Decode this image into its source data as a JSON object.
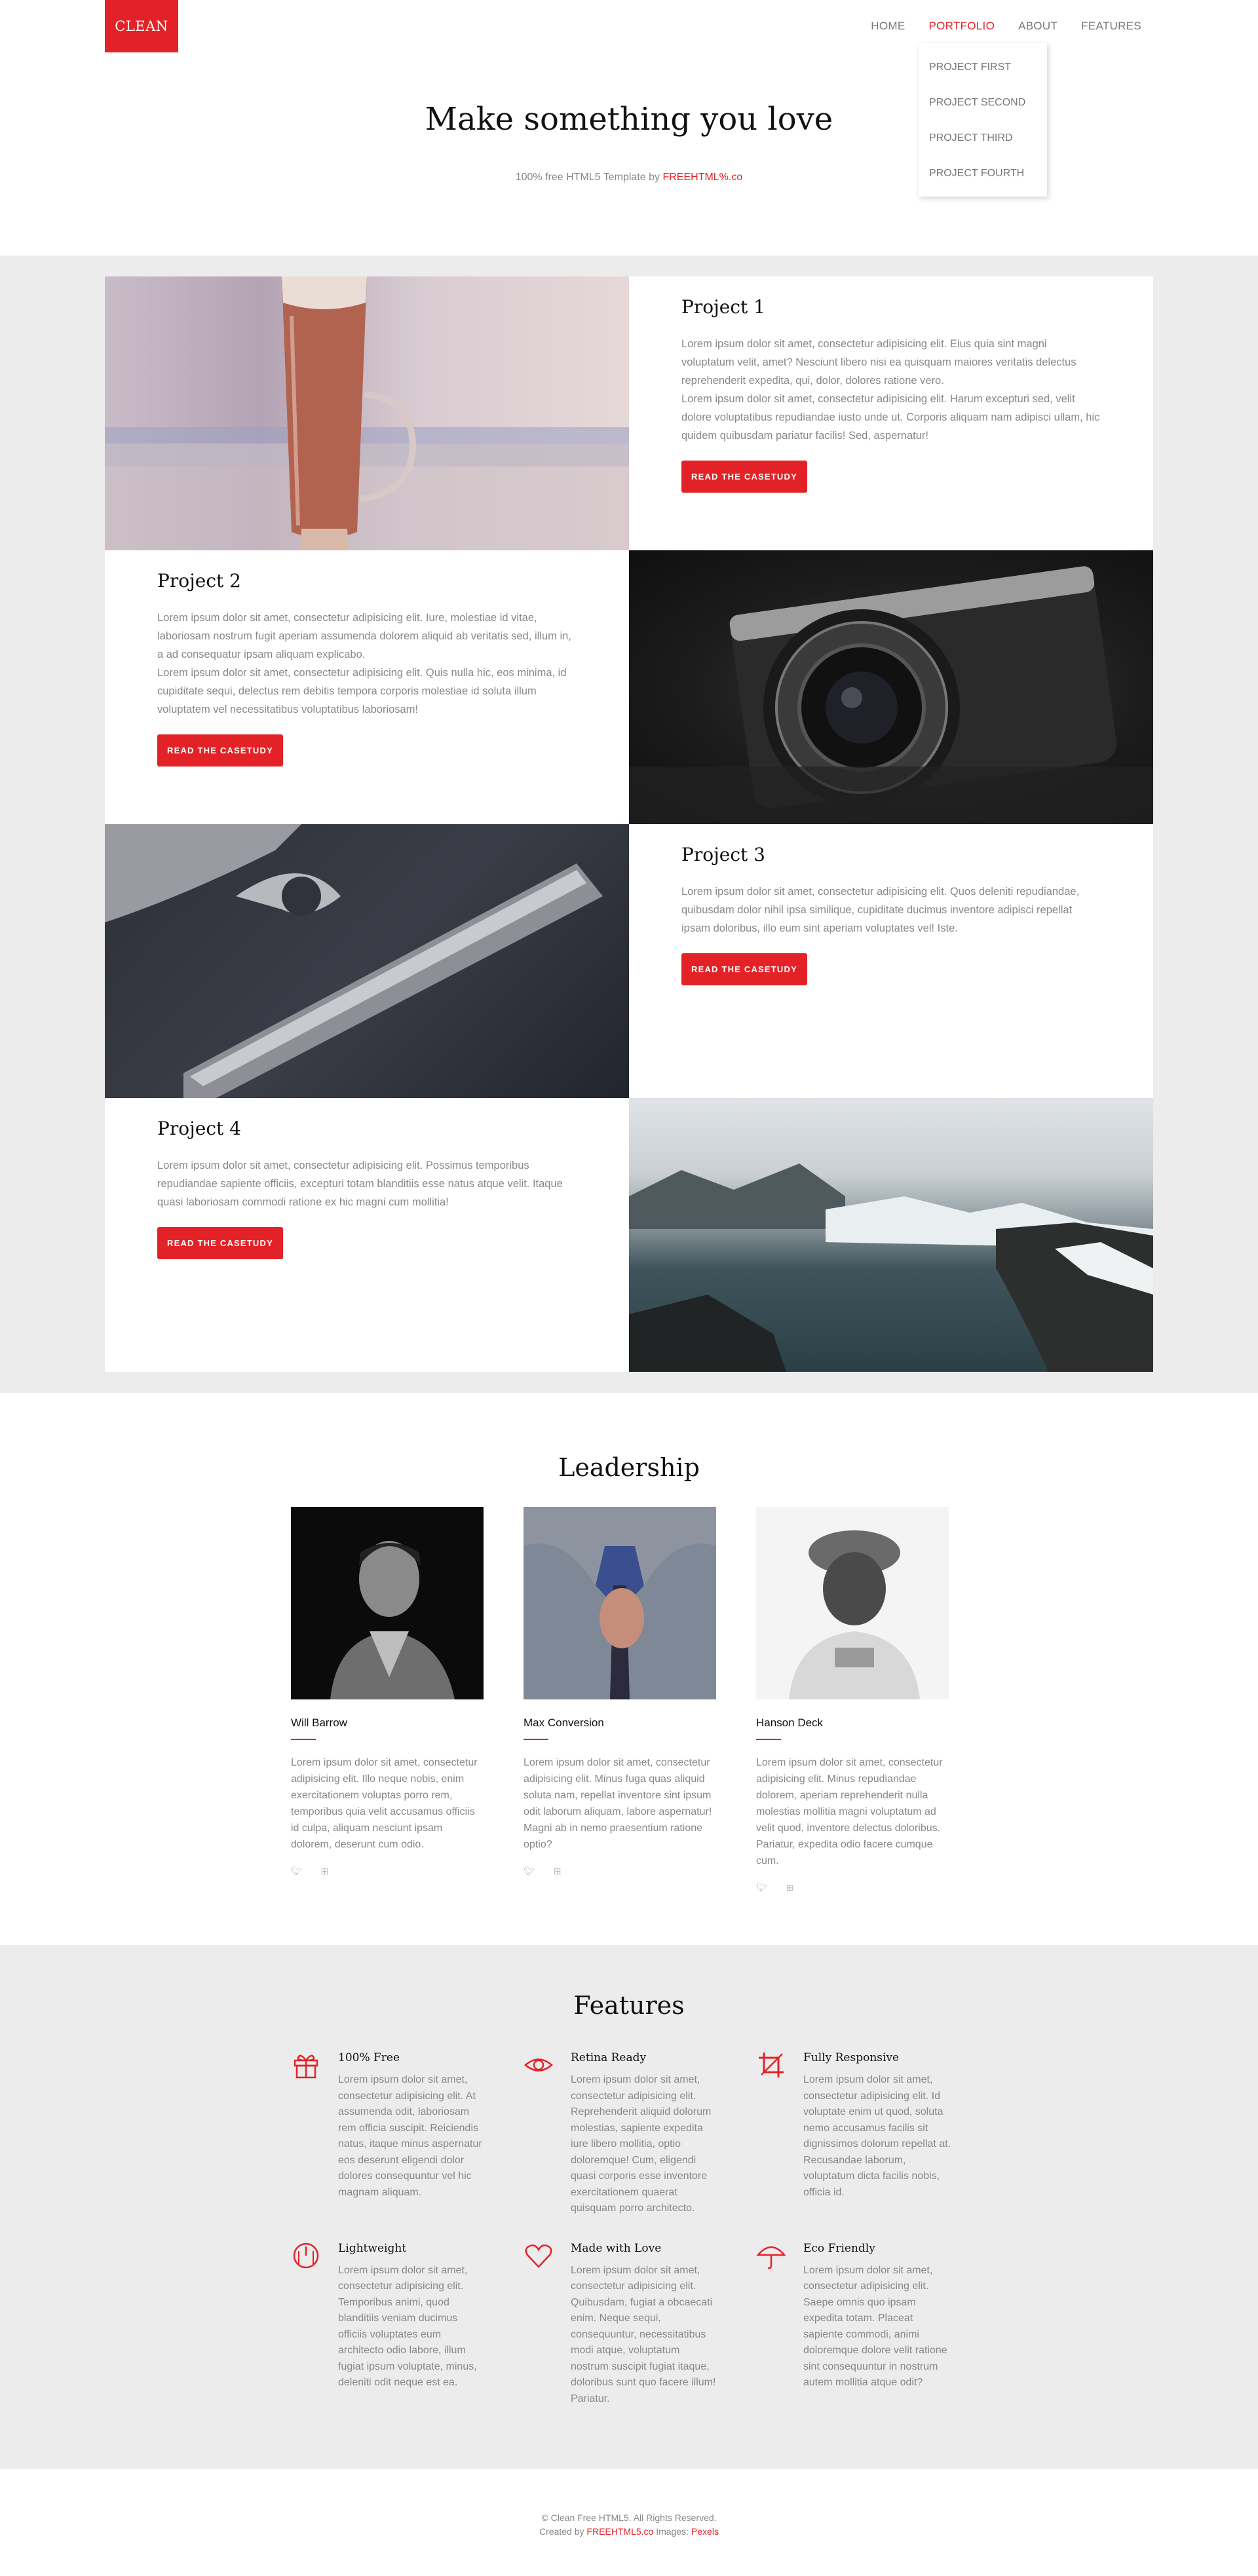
{
  "brand": {
    "logo": "CLEAN",
    "accent": "#e32227"
  },
  "nav": {
    "items": [
      {
        "label": "HOME"
      },
      {
        "label": "PORTFOLIO",
        "active": true
      },
      {
        "label": "ABOUT"
      },
      {
        "label": "FEATURES"
      }
    ],
    "dropdown": [
      "PROJECT FIRST",
      "PROJECT SECOND",
      "PROJECT THIRD",
      "PROJECT FOURTH"
    ]
  },
  "hero": {
    "title": "Make something you love",
    "subtitle_prefix": "100% free HTML5 Template by",
    "subtitle_link": "FREEHTML%.co"
  },
  "projects": [
    {
      "title": "Project 1",
      "body": "Lorem ipsum dolor sit amet, consectetur adipisicing elit. Eius quia sint magni voluptatum velit, amet? Nesciunt libero nisi ea quisquam maiores veritatis delectus reprehenderit expedita, qui, dolor, dolores ratione vero.\nLorem ipsum dolor sit amet, consectetur adipisicing elit. Harum excepturi sed, velit dolore voluptatibus repudiandae iusto unde ut. Corporis aliquam nam adipisci ullam, hic quidem quibusdam pariatur facilis! Sed, aspernatur!",
      "button": "READ THE CASETUDY",
      "image": "coffee-glass"
    },
    {
      "title": "Project 2",
      "body": "Lorem ipsum dolor sit amet, consectetur adipisicing elit. Iure, molestiae id vitae, laboriosam nostrum fugit aperiam assumenda dolorem aliquid ab veritatis sed, illum in, a ad consequatur ipsam aliquam explicabo.\nLorem ipsum dolor sit amet, consectetur adipisicing elit. Quis nulla hic, eos minima, id cupiditate sequi, delectus rem debitis tempora corporis molestiae id soluta illum voluptatem vel necessitatibus voluptatibus laboriosam!",
      "button": "READ THE CASETUDY",
      "image": "camera"
    },
    {
      "title": "Project 3",
      "body": "Lorem ipsum dolor sit amet, consectetur adipisicing elit. Quos deleniti repudiandae, quibusdam dolor nihil ipsa similique, cupiditate ducimus inventore adipisci repellat ipsam doloribus, illo eum sint aperiam voluptates vel! Iste.",
      "button": "READ THE CASETUDY",
      "image": "wrenches"
    },
    {
      "title": "Project 4",
      "body": "Lorem ipsum dolor sit amet, consectetur adipisicing elit. Possimus temporibus repudiandae sapiente officiis, excepturi totam blanditiis esse natus atque velit. Itaque quasi laboriosam commodi ratione ex hic magni cum mollitia!",
      "button": "READ THE CASETUDY",
      "image": "mountain-lake"
    }
  ],
  "leadership": {
    "title": "Leadership",
    "members": [
      {
        "name": "Will Barrow",
        "bio": "Lorem ipsum dolor sit amet, consectetur adipisicing elit. Illo neque nobis, enim exercitationem voluptas porro rem, temporibus quia velit accusamus officiis id culpa, aliquam nesciunt ipsam dolorem, deserunt cum odio."
      },
      {
        "name": "Max Conversion",
        "bio": "Lorem ipsum dolor sit amet, consectetur adipisicing elit. Minus fuga quas aliquid soluta nam, repellat inventore sint ipsum odit laborum aliquam, labore aspernatur! Magni ab in nemo praesentium ratione optio?"
      },
      {
        "name": "Hanson Deck",
        "bio": "Lorem ipsum dolor sit amet, consectetur adipisicing elit. Minus repudiandae dolorem, aperiam reprehenderit nulla molestias mollitia magni voluptatum ad velit quod, inventore delectus doloribus. Pariatur, expedita odio facere cumque cum."
      }
    ],
    "social_icons": [
      "twitter-icon",
      "dribbble-icon"
    ]
  },
  "features": {
    "title": "Features",
    "items": [
      {
        "name": "100% Free",
        "icon": "gift-icon",
        "body": "Lorem ipsum dolor sit amet, consectetur adipisicing elit. At assumenda odit, laboriosam rem officia suscipit. Reiciendis natus, itaque minus aspernatur eos deserunt eligendi dolor dolores consequuntur vel hic magnam aliquam."
      },
      {
        "name": "Retina Ready",
        "icon": "eye-icon",
        "body": "Lorem ipsum dolor sit amet, consectetur adipisicing elit. Reprehenderit aliquid dolorum molestias, sapiente expedita iure libero mollitia, optio doloremque! Cum, eligendi quasi corporis esse inventore exercitationem quaerat quisquam porro architecto."
      },
      {
        "name": "Fully Responsive",
        "icon": "crop-icon",
        "body": "Lorem ipsum dolor sit amet, consectetur adipisicing elit. Id voluptate enim ut quod, soluta nemo accusamus facilis sit dignissimos dolorum repellat at. Recusandae laborum, voluptatum dicta facilis nobis, officia id."
      },
      {
        "name": "Lightweight",
        "icon": "gauge-icon",
        "body": "Lorem ipsum dolor sit amet, consectetur adipisicing elit. Temporibus animi, quod blanditiis veniam ducimus officiis voluptates eum architecto odio labore, illum fugiat ipsum voluptate, minus, deleniti odit neque est ea."
      },
      {
        "name": "Made with Love",
        "icon": "heart-icon",
        "body": "Lorem ipsum dolor sit amet, consectetur adipisicing elit. Quibusdam, fugiat a obcaecati enim. Neque sequi, consequuntur, necessitatibus modi atque, voluptatum nostrum suscipit fugiat itaque, doloribus sunt quo facere illum! Pariatur."
      },
      {
        "name": "Eco Friendly",
        "icon": "umbrella-icon",
        "body": "Lorem ipsum dolor sit amet, consectetur adipisicing elit. Saepe omnis quo ipsam expedita totam. Placeat sapiente commodi, animi doloremque dolore velit ratione sint consequuntur in nostrum autem mollitia atque odit?"
      }
    ]
  },
  "footer": {
    "copyright": "© Clean Free HTML5. All Rights Reserved.",
    "created_prefix": "Created by",
    "created_link": "FREEHTML5.co",
    "images_prefix": "Images:",
    "images_link": "Pexels"
  }
}
